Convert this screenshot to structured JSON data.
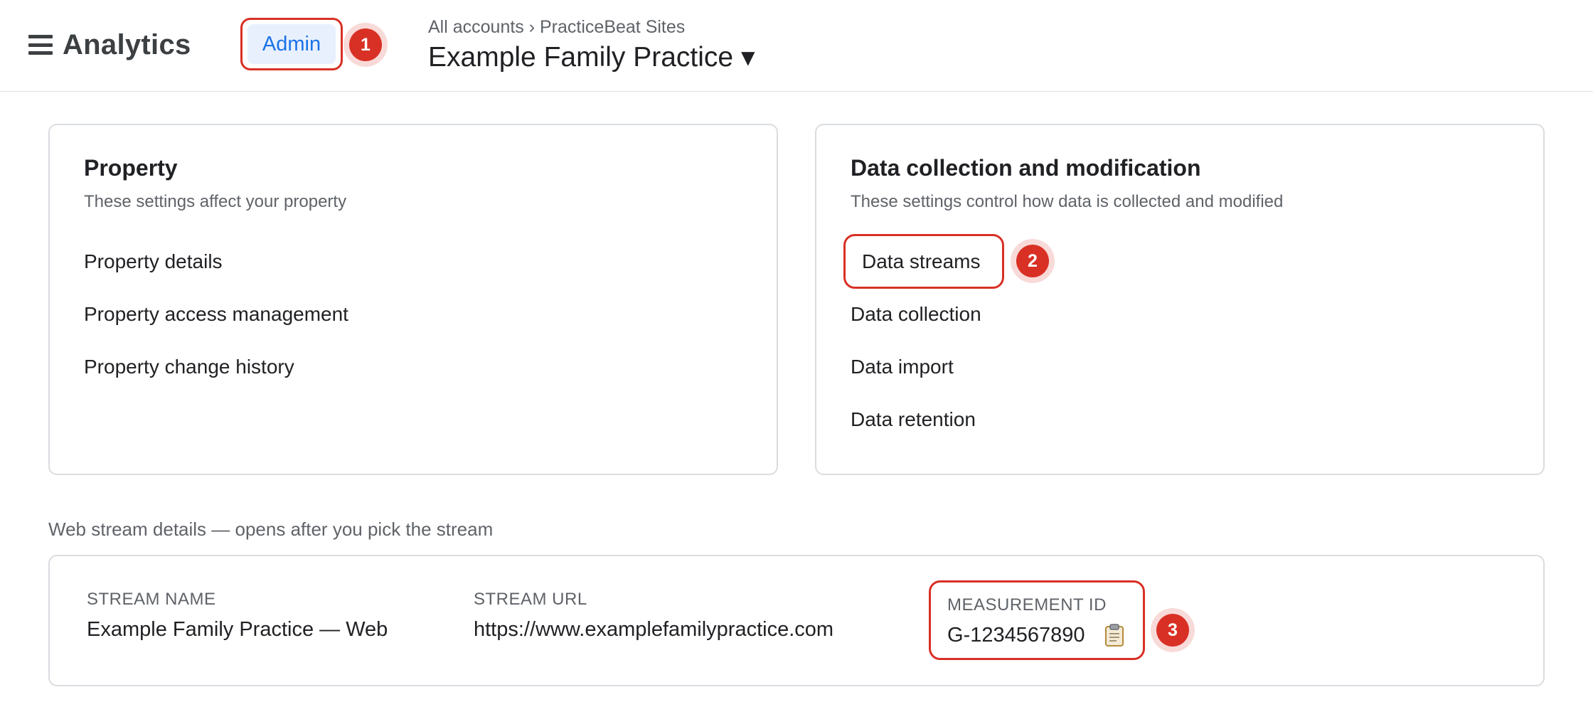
{
  "header": {
    "app_title": "Analytics",
    "admin_label": "Admin",
    "breadcrumb": "All accounts › PracticeBeat Sites",
    "property_name": "Example Family Practice ▾"
  },
  "property_card": {
    "title": "Property",
    "subtitle": "These settings affect your property",
    "items": [
      "Property details",
      "Property access management",
      "Property change history"
    ]
  },
  "data_card": {
    "title": "Data collection and modification",
    "subtitle": "These settings control how data is collected and modified",
    "items": [
      "Data streams",
      "Data collection",
      "Data import",
      "Data retention"
    ]
  },
  "stream_section": {
    "label": "Web stream details — opens after you pick the stream",
    "stream_name_label": "STREAM NAME",
    "stream_name_value": "Example Family Practice — Web",
    "stream_url_label": "STREAM URL",
    "stream_url_value": "https://www.examplefamilypractice.com",
    "measurement_id_label": "MEASUREMENT ID",
    "measurement_id_value": "G-1234567890"
  },
  "annotations": {
    "step1": "1",
    "step2": "2",
    "step3": "3"
  },
  "icons": {
    "menu": "menu-icon",
    "copy": "clipboard-icon"
  },
  "colors": {
    "accent": "#1a73e8",
    "highlight": "#d93025",
    "admin_bg": "#e8f0fe"
  }
}
